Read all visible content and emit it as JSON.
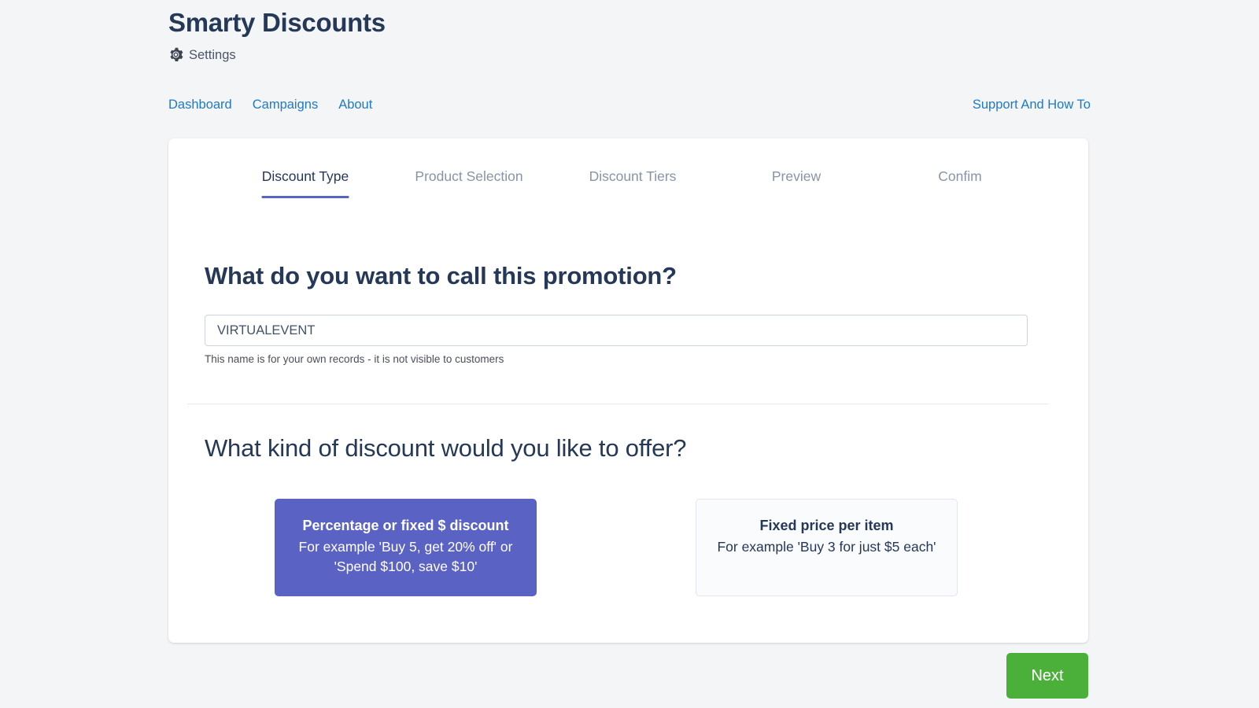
{
  "header": {
    "app_title": "Smarty Discounts",
    "settings_label": "Settings",
    "settings_icon": "gear-icon"
  },
  "topnav": {
    "left_links": [
      {
        "label": "Dashboard"
      },
      {
        "label": "Campaigns"
      },
      {
        "label": "About"
      }
    ],
    "right_link": {
      "label": "Support And How To"
    }
  },
  "wizard": {
    "steps": [
      {
        "label": "Discount Type",
        "active": true
      },
      {
        "label": "Product Selection",
        "active": false
      },
      {
        "label": "Discount Tiers",
        "active": false
      },
      {
        "label": "Preview",
        "active": false
      },
      {
        "label": "Confim",
        "active": false
      }
    ],
    "active_step_index": 0,
    "active_underline_color": "#5566c4"
  },
  "promotion_name": {
    "heading": "What do you want to call this promotion?",
    "input_value": "VIRTUALEVENT",
    "input_placeholder": "",
    "helper_text": "This name is for your own records - it is not visible to customers"
  },
  "discount_kind": {
    "heading": "What kind of discount would you like to offer?",
    "options": [
      {
        "title": "Percentage or fixed $ discount",
        "description": "For example 'Buy 5, get 20% off' or 'Spend $100, save $10'",
        "selected": true,
        "background": "#5a62c4",
        "text_color": "#ffffff"
      },
      {
        "title": "Fixed price per item",
        "description": "For example 'Buy 3 for just $5 each'",
        "selected": false,
        "background": "#fafbfc",
        "text_color": "#253858"
      }
    ]
  },
  "footer": {
    "next_label": "Next",
    "next_color": "#4bb03a"
  },
  "colors": {
    "page_background": "#f4f5f7",
    "card_background": "#ffffff",
    "link_blue": "#1f7ac4",
    "heading_navy": "#253858",
    "muted_gray": "#8894a6"
  }
}
